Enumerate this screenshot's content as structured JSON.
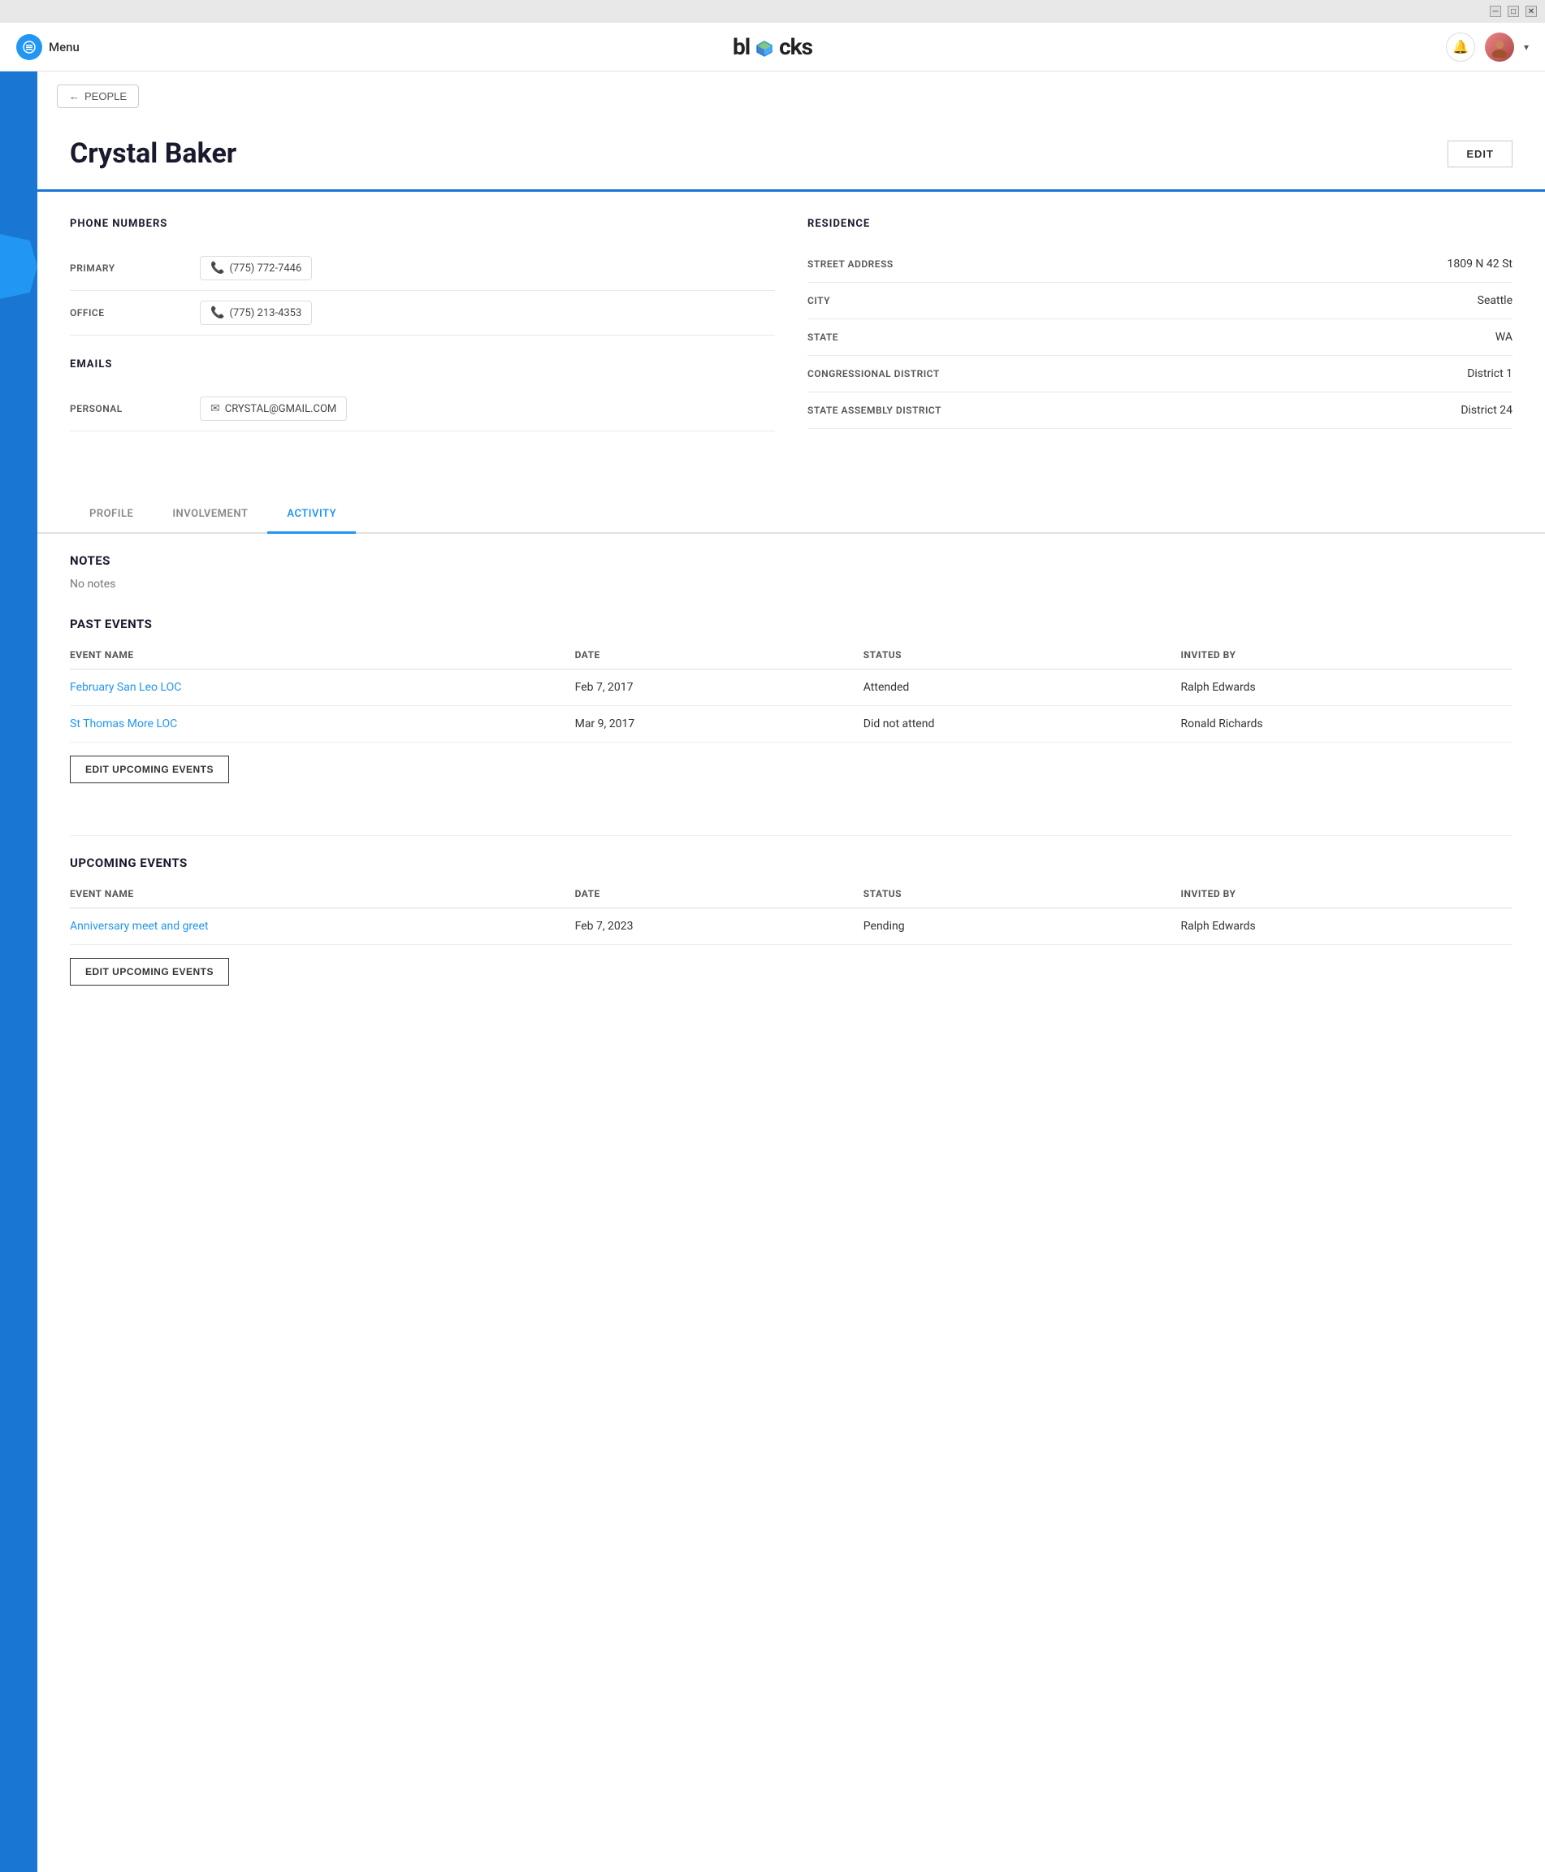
{
  "window": {
    "min_label": "─",
    "max_label": "□",
    "close_label": "✕"
  },
  "nav": {
    "menu_label": "Menu",
    "logo_text_before": "bl",
    "logo_text_after": "cks",
    "notif_icon": "🔔",
    "avatar_icon": "👤",
    "chevron": "▾"
  },
  "breadcrumb": {
    "arrow": "←",
    "label": "PEOPLE"
  },
  "person": {
    "name": "Crystal Baker",
    "edit_label": "EDIT"
  },
  "phone_numbers": {
    "section_title": "PHONE NUMBERS",
    "primary_label": "PRIMARY",
    "primary_value": "(775) 772-7446",
    "office_label": "OFFICE",
    "office_value": "(775) 213-4353"
  },
  "emails": {
    "section_title": "EMAILS",
    "personal_label": "PERSONAL",
    "personal_value": "CRYSTAL@GMAIL.COM"
  },
  "residence": {
    "section_title": "RESIDENCE",
    "fields": [
      {
        "label": "STREET ADDRESS",
        "value": "1809 N 42 St"
      },
      {
        "label": "CITY",
        "value": "Seattle"
      },
      {
        "label": "STATE",
        "value": "WA"
      },
      {
        "label": "CONGRESSIONAL DISTRICT",
        "value": "District 1"
      },
      {
        "label": "STATE ASSEMBLY DISTRICT",
        "value": "District 24"
      }
    ]
  },
  "tabs": [
    {
      "label": "PROFILE",
      "active": false
    },
    {
      "label": "INVOLVEMENT",
      "active": false
    },
    {
      "label": "ACTIVITY",
      "active": true
    }
  ],
  "activity": {
    "notes_title": "NOTES",
    "no_notes": "No notes",
    "past_events_title": "PAST EVENTS",
    "past_events_cols": [
      "EVENT NAME",
      "DATE",
      "STATUS",
      "INVITED BY"
    ],
    "past_events": [
      {
        "name": "February San Leo LOC",
        "date": "Feb 7, 2017",
        "status": "Attended",
        "invited_by": "Ralph Edwards"
      },
      {
        "name": "St Thomas More LOC",
        "date": "Mar 9, 2017",
        "status": "Did not attend",
        "invited_by": "Ronald Richards"
      }
    ],
    "edit_past_label": "EDIT UPCOMING EVENTS",
    "upcoming_events_title": "UPCOMING EVENTS",
    "upcoming_events_cols": [
      "EVENT NAME",
      "DATE",
      "STATUS",
      "INVITED BY"
    ],
    "upcoming_events": [
      {
        "name": "Anniversary meet and greet",
        "date": "Feb 7, 2023",
        "status": "Pending",
        "invited_by": "Ralph Edwards"
      }
    ],
    "edit_upcoming_label": "EDIT UPCOMING EVENTS"
  }
}
